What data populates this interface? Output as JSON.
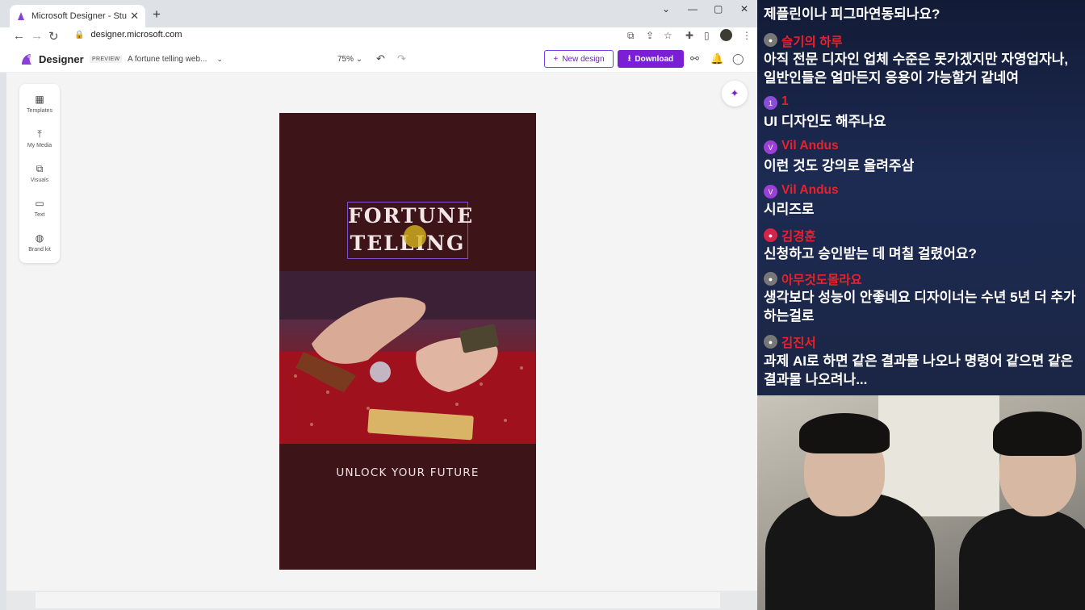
{
  "browser": {
    "tab_title": "Microsoft Designer - Stunning d",
    "tab_close": "✕",
    "new_tab": "+",
    "url": "designer.microsoft.com",
    "window_controls": [
      "⌄",
      "—",
      "▢",
      "✕"
    ]
  },
  "app": {
    "brand": "Designer",
    "badge": "PREVIEW",
    "doc_title": "A fortune telling web...",
    "zoom": "75%",
    "new_design": "New design",
    "download": "Download",
    "accent": "#7b1fd6"
  },
  "sidebar": {
    "items": [
      {
        "label": "Templates",
        "icon": "templates-icon"
      },
      {
        "label": "My Media",
        "icon": "upload-icon"
      },
      {
        "label": "Visuals",
        "icon": "shapes-icon"
      },
      {
        "label": "Text",
        "icon": "text-icon"
      },
      {
        "label": "Brand kit",
        "icon": "palette-icon"
      }
    ]
  },
  "canvas": {
    "title_line1": "FORTUNE",
    "title_line2": "TELLING",
    "tagline": "UNLOCK YOUR FUTURE",
    "background": "#3d1519"
  },
  "chat": {
    "messages": [
      {
        "name": "",
        "text": "제플린이나 피그마연동되나요?"
      },
      {
        "name": "슬기의 하루",
        "text": "아직 전문 디자인 업체 수준은 못가겠지만 자영업자나, 일반인들은 얼마든지 응용이 가능할거 같네여"
      },
      {
        "name": "1",
        "text": "UI 디자인도 해주나요"
      },
      {
        "name": "Vil Andus",
        "text": "이런 것도 강의로 올려주삼"
      },
      {
        "name": "Vil Andus",
        "text": "시리즈로"
      },
      {
        "name": "김경훈",
        "text": "신청하고 승인받는 데 며칠 걸렸어요?"
      },
      {
        "name": "아무것도몰라요",
        "text": "생각보다 성능이 안좋네요 디자이너는 수년 5년 더 추가하는걸로"
      },
      {
        "name": "김진서",
        "text": "과제 AI로 하면 같은 결과물 나오나 명령어 같으면 같은 결과물 나오려나..."
      }
    ]
  }
}
